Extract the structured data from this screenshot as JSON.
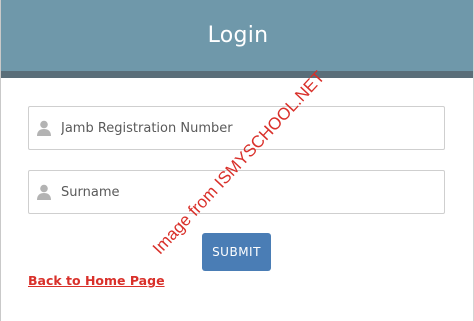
{
  "header": {
    "title": "Login"
  },
  "form": {
    "registration_field": {
      "placeholder": "Jamb Registration Number",
      "value": "",
      "icon": "user-icon"
    },
    "surname_field": {
      "placeholder": "Surname",
      "value": "",
      "icon": "user-icon"
    },
    "submit_label": "SUBMIT"
  },
  "links": {
    "back_home": "Back to Home Page"
  },
  "watermark": {
    "text": "Image from ISMYSCHOOL.NET"
  },
  "colors": {
    "header_bg": "#6f98aa",
    "header_band": "#5a6e79",
    "submit_bg": "#4a7db5",
    "link_red": "#d9302a"
  }
}
